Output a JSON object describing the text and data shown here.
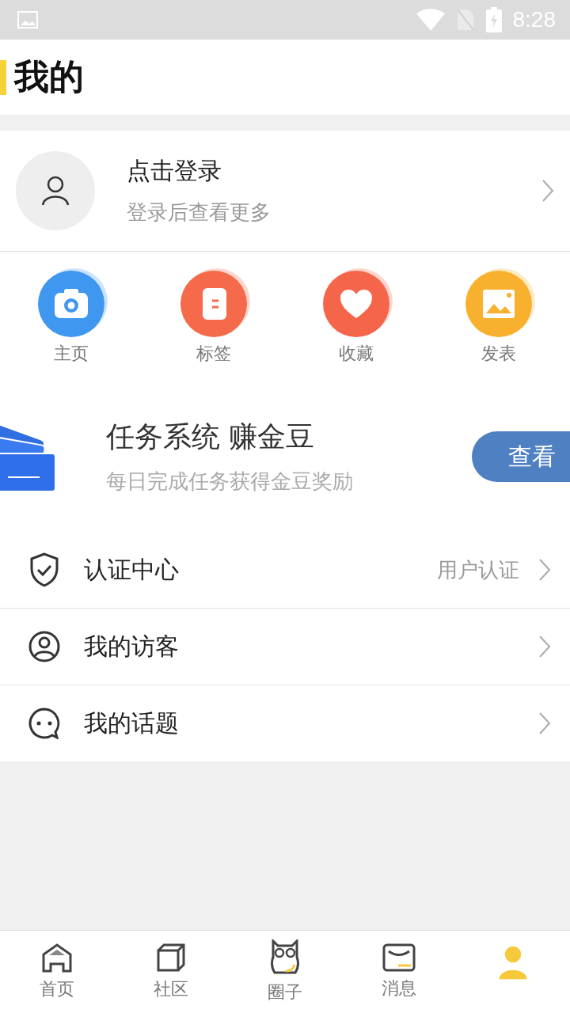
{
  "status_bar": {
    "time": "8:28"
  },
  "header": {
    "title": "我的"
  },
  "profile": {
    "name": "点击登录",
    "hint": "登录后查看更多"
  },
  "shortcuts": [
    {
      "label": "主页",
      "color": "#3f97ef"
    },
    {
      "label": "标签",
      "color": "#f46a4a"
    },
    {
      "label": "收藏",
      "color": "#f5654a"
    },
    {
      "label": "发表",
      "color": "#f8b12e"
    }
  ],
  "banner": {
    "title": "任务系统 赚金豆",
    "subtitle": "每日完成任务获得金豆奖励",
    "button": "查看"
  },
  "menu": [
    {
      "label": "认证中心",
      "value": "用户认证"
    },
    {
      "label": "我的访客"
    },
    {
      "label": "我的话题"
    }
  ],
  "bottom_nav": [
    {
      "label": "首页",
      "selected": false
    },
    {
      "label": "社区",
      "selected": false
    },
    {
      "label": "圈子",
      "selected": false
    },
    {
      "label": "消息",
      "selected": false
    },
    {
      "selected": true
    }
  ]
}
